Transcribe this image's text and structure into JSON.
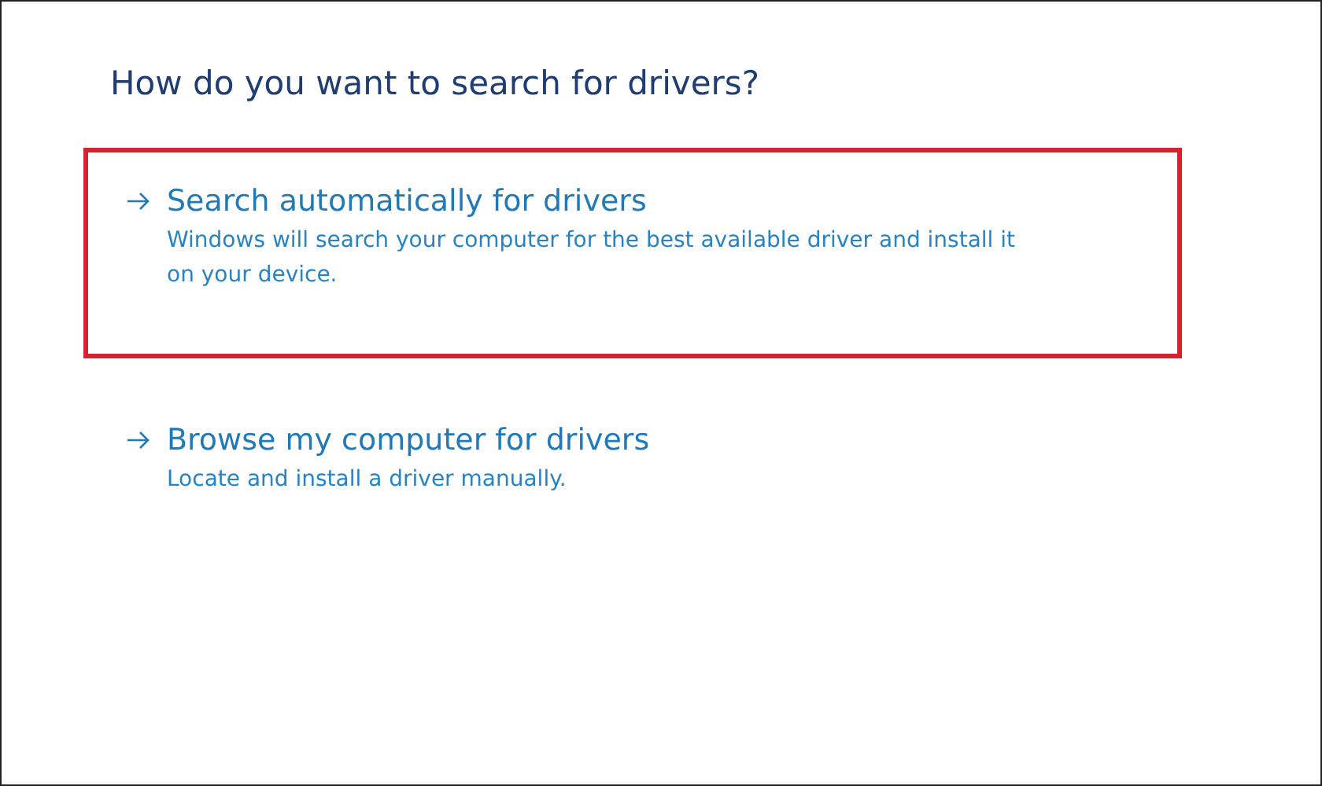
{
  "heading": "How do you want to search for drivers?",
  "options": [
    {
      "title": "Search automatically for drivers",
      "description": "Windows will search your computer for the best available driver and install it on your device.",
      "highlighted": true
    },
    {
      "title": "Browse my computer for drivers",
      "description": "Locate and install a driver manually.",
      "highlighted": false
    }
  ]
}
